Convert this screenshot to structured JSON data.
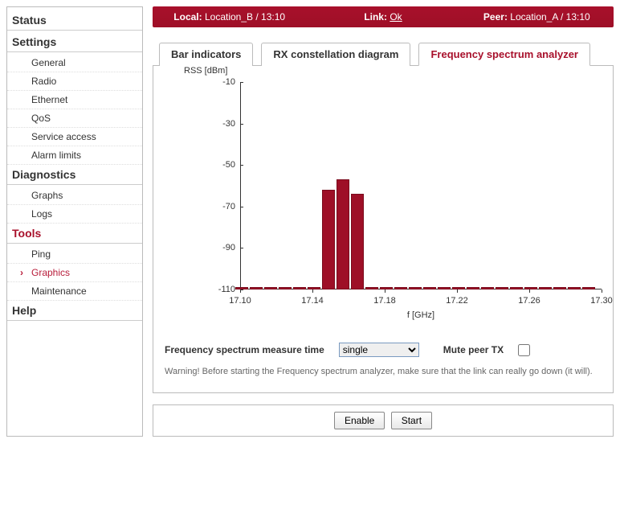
{
  "sidebar": {
    "sections": [
      {
        "title": "Status",
        "items": []
      },
      {
        "title": "Settings",
        "items": [
          "General",
          "Radio",
          "Ethernet",
          "QoS",
          "Service access",
          "Alarm limits"
        ]
      },
      {
        "title": "Diagnostics",
        "items": [
          "Graphs",
          "Logs"
        ]
      },
      {
        "title": "Tools",
        "active": true,
        "items": [
          "Ping",
          "Graphics",
          "Maintenance"
        ],
        "activeItem": "Graphics"
      },
      {
        "title": "Help",
        "items": []
      }
    ]
  },
  "statusbar": {
    "local_label": "Local:",
    "local_value": "Location_B / 13:10",
    "link_label": "Link:",
    "link_value": "Ok",
    "peer_label": "Peer:",
    "peer_value": "Location_A / 13:10"
  },
  "tabs": {
    "bar": "Bar indicators",
    "rx": "RX constellation diagram",
    "freq": "Frequency spectrum analyzer"
  },
  "chart_data": {
    "type": "bar",
    "title": "",
    "ylabel": "RSS [dBm]",
    "xlabel": "f [GHz]",
    "ylim": [
      -110,
      -10
    ],
    "yticks": [
      -10,
      -30,
      -50,
      -70,
      -90,
      -110
    ],
    "xlim": [
      17.1,
      17.3
    ],
    "xticks": [
      17.1,
      17.14,
      17.18,
      17.22,
      17.26,
      17.3
    ],
    "x": [
      17.101,
      17.109,
      17.117,
      17.125,
      17.133,
      17.141,
      17.149,
      17.157,
      17.165,
      17.173,
      17.181,
      17.189,
      17.197,
      17.205,
      17.213,
      17.221,
      17.229,
      17.237,
      17.245,
      17.253,
      17.261,
      17.269,
      17.277,
      17.285,
      17.293
    ],
    "values": [
      -110,
      -110,
      -110,
      -110,
      -110,
      -110,
      -62,
      -57,
      -64,
      -110,
      -110,
      -110,
      -110,
      -110,
      -110,
      -110,
      -110,
      -110,
      -110,
      -110,
      -110,
      -110,
      -110,
      -110,
      -110
    ]
  },
  "controls": {
    "measure_label": "Frequency spectrum measure time",
    "measure_value": "single",
    "mute_label": "Mute peer TX",
    "mute_checked": false
  },
  "warning": "Warning! Before starting the Frequency spectrum analyzer, make sure that the link can really go down (it will).",
  "footer": {
    "enable": "Enable",
    "start": "Start"
  }
}
